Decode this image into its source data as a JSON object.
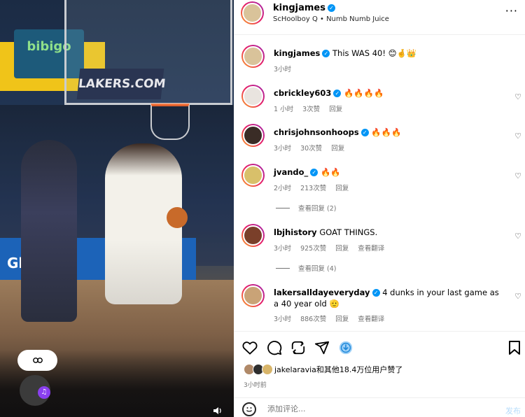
{
  "media": {
    "sign_bibigo": "bibigo",
    "sign_lakers": "LAKERS.COM",
    "sign_globe": "Globe"
  },
  "header": {
    "username": "kingjames",
    "subtitle": "ScHoolboy Q • Numb Numb Juice",
    "more": "···"
  },
  "caption": {
    "username": "kingjames",
    "text": "This WAS 40! 😊🤞👑",
    "time": "3小时"
  },
  "comments": [
    {
      "username": "cbrickley603",
      "text": "🔥🔥🔥🔥",
      "time": "1 小时",
      "likes": "3次赞",
      "reply": "回复",
      "translate": "",
      "verified": true,
      "avatar_color": "#e9e4df"
    },
    {
      "username": "chrisjohnsonhoops",
      "text": "🔥🔥🔥",
      "time": "3小时",
      "likes": "30次赞",
      "reply": "回复",
      "translate": "",
      "verified": true,
      "avatar_color": "#3a2c26"
    },
    {
      "username": "jvando_",
      "text": "🔥🔥",
      "time": "2小时",
      "likes": "213次赞",
      "reply": "回复",
      "translate": "",
      "verified": true,
      "avatar_color": "#d8c06a"
    },
    {
      "username": "lbjhistory",
      "text": "GOAT THINGS.",
      "time": "3小时",
      "likes": "925次赞",
      "reply": "回复",
      "translate": "查看翻译",
      "verified": false,
      "avatar_color": "#7a3f2a"
    },
    {
      "username": "lakersalldayeveryday",
      "text": "4 dunks in your last game as a 40 year old 🫡",
      "time": "3小时",
      "likes": "886次赞",
      "reply": "回复",
      "translate": "查看翻译",
      "verified": true,
      "avatar_color": "#c9a377"
    }
  ],
  "replies": [
    {
      "label": "查看回复 (2)"
    },
    {
      "label": "查看回复 (4)"
    }
  ],
  "likes": {
    "text": "jakelaravia和其他18.4万位用户赞了"
  },
  "posted": "3小时前",
  "composer": {
    "placeholder": "添加评论...",
    "post": "发布"
  }
}
